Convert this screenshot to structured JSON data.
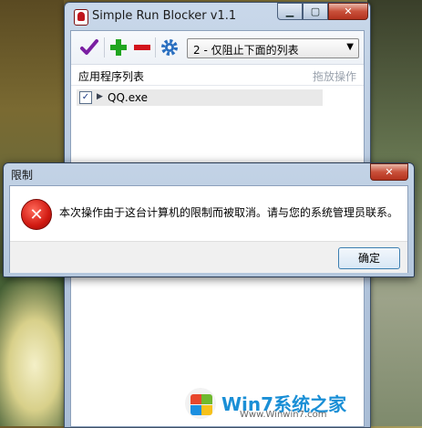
{
  "app": {
    "title": "Simple Run Blocker v1.1",
    "caption": {
      "minimize": "▁",
      "maximize": "▢",
      "close": "✕"
    },
    "toolbar": {
      "icons": [
        "checkmark-icon",
        "add-icon",
        "remove-icon",
        "gear-icon"
      ],
      "mode_select": "2 - 仅阻止下面的列表",
      "dropdown_arrow": "▼"
    },
    "list_header": {
      "left": "应用程序列表",
      "right": "拖放操作"
    },
    "items": [
      {
        "label": "QQ.exe",
        "checked": true
      }
    ],
    "logo": {
      "text": "Win7系统之家",
      "sub": "Www.Winwin7.com"
    }
  },
  "dialog": {
    "title": "限制",
    "message": "本次操作由于这台计算机的限制而被取消。请与您的系统管理员联系。",
    "ok_label": "确定",
    "close": "✕"
  },
  "colors": {
    "accent_check": "#7a1fa2",
    "accent_add": "#1fa51f",
    "accent_remove": "#d2141c",
    "accent_gear": "#2a6fc0"
  }
}
